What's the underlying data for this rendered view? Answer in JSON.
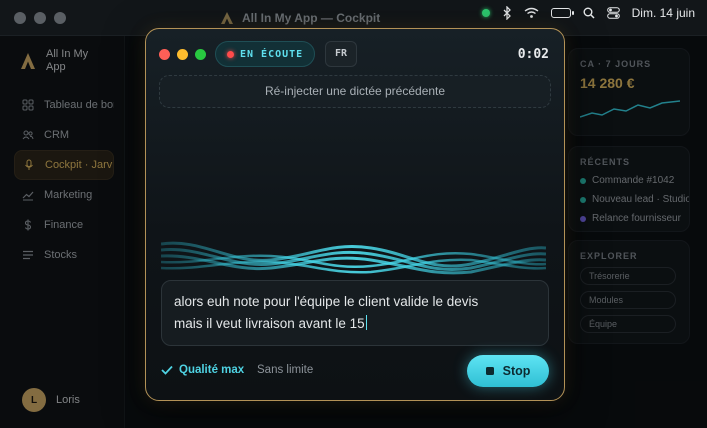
{
  "window": {
    "title": "All In My App — Cockpit"
  },
  "menubar": {
    "date": "Dim. 14 juin",
    "battery_level": 0.75
  },
  "sidebar": {
    "brand": "All In My App",
    "items": [
      {
        "label": "Tableau de bord",
        "icon": "grid-icon",
        "active": false
      },
      {
        "label": "CRM",
        "icon": "users-icon",
        "active": false
      },
      {
        "label": "Cockpit · Jarvis",
        "icon": "mic-icon",
        "active": true
      },
      {
        "label": "Marketing",
        "icon": "trend-icon",
        "active": false
      },
      {
        "label": "Finance",
        "icon": "dollar-icon",
        "active": false
      },
      {
        "label": "Stocks",
        "icon": "list-icon",
        "active": false
      }
    ],
    "user": {
      "name": "Loris",
      "initial": "L"
    }
  },
  "right_panel": {
    "ca_caption": "CA · 7 JOURS",
    "ca_value": "14 280 €",
    "recents_caption": "RÉCENTS",
    "recents": [
      {
        "label": "Commande #1042",
        "color": "#2bbfb0"
      },
      {
        "label": "Nouveau lead · Studio",
        "color": "#2bbfb0"
      },
      {
        "label": "Relance fournisseur",
        "color": "#7b6cf0"
      }
    ],
    "explore_caption": "EXPLORER",
    "explore": [
      "Trésorerie",
      "Modules",
      "Équipe"
    ]
  },
  "voice": {
    "status": "EN ÉCOUTE",
    "language": "FR",
    "timer": "0:02",
    "reinject_label": "Ré-injecter une dictée précédente",
    "transcript_line1": "alors euh note pour l'équipe le client valide le devis",
    "transcript_line2": "mais il veut livraison avant le 15",
    "quality_label": "Qualité max",
    "limit_label": "Sans limite",
    "stop_label": "Stop"
  },
  "colors": {
    "accent_cyan": "#4fd3e3",
    "accent_gold": "#d9b45f",
    "record_red": "#ff4b4b"
  }
}
